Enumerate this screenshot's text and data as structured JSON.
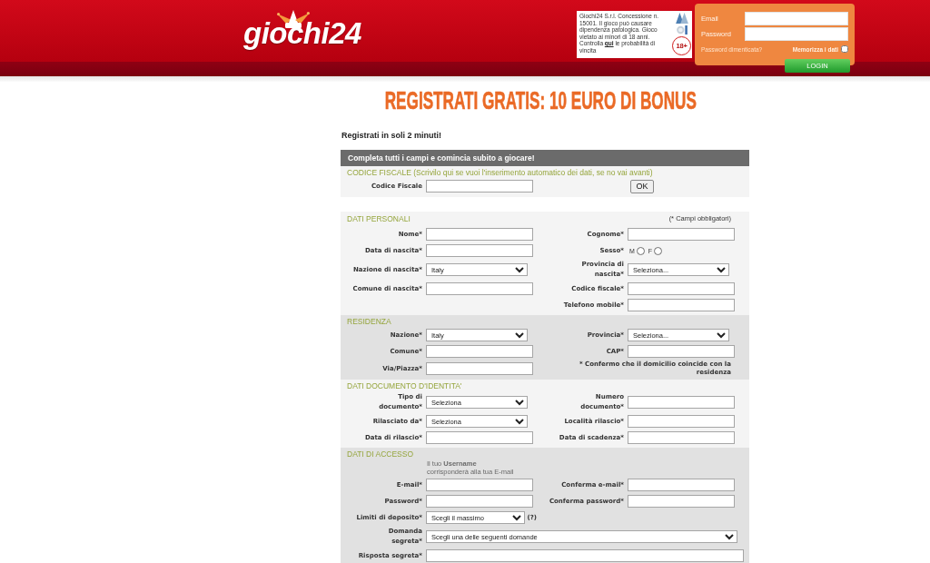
{
  "header": {
    "logo": "giochi24",
    "disclaimer": {
      "text": "Giochi24 S.r.l. Concessione n. 15001. Il gioco può causare dipendenza patologica. Gioco vietato ai minori di 18 anni. Controlla",
      "link": "qui",
      "text_after": "le probabilità di vincita"
    },
    "age_badge": "18+"
  },
  "login": {
    "email_label": "Email",
    "password_label": "Password",
    "forgot_password": "Password dimenticata?",
    "remember": {
      "label": "Memorizza i dati",
      "checked": false
    },
    "button": "LOGIN"
  },
  "banner_title": "REGISTRATI GRATIS: 10 EURO DI BONUS",
  "intro": "Registrati in soli 2 minuti!",
  "form": {
    "header": "Completa tutti i campi e comincia subito a giocare!",
    "sections": [
      {
        "kind": "lookup",
        "title": "CODICE FISCALE (Scrivilo qui se vuoi l'inserimento automatico dei dati, se no vai avanti)",
        "shaded": false,
        "rows": [
          {
            "left": {
              "kind": "text",
              "label": "Codice Fiscale"
            },
            "right": {
              "kind": "button",
              "text": "OK"
            }
          }
        ]
      },
      {
        "kind": "fields",
        "title": "DATI PERSONALI",
        "note": "(* Campi obbligatori)",
        "shaded": false,
        "rows": [
          {
            "left": {
              "kind": "text",
              "label": "Nome*"
            },
            "right": {
              "kind": "text",
              "label": "Cognome*"
            }
          },
          {
            "left": {
              "kind": "text",
              "label": "Data di nascita*"
            },
            "right": {
              "kind": "radio",
              "label": "Sesso*",
              "options": [
                {
                  "label": "M",
                  "selected": false
                },
                {
                  "label": "F",
                  "selected": false
                }
              ]
            }
          },
          {
            "left": {
              "kind": "select",
              "label": "Nazione di nascita*",
              "value": "Italy"
            },
            "right": {
              "kind": "select",
              "label": "Provincia di\nnascita*",
              "value": "Seleziona..."
            }
          },
          {
            "left": {
              "kind": "text",
              "label": "Comune di nascita*"
            },
            "right": {
              "kind": "text",
              "label": "Codice fiscale*"
            }
          },
          {
            "right": {
              "kind": "text",
              "label": "Telefono mobile*"
            }
          }
        ]
      },
      {
        "kind": "fields",
        "title": "RESIDENZA",
        "shaded": true,
        "rows": [
          {
            "left": {
              "kind": "select",
              "label": "Nazione*",
              "value": "Italy"
            },
            "right": {
              "kind": "select",
              "label": "Provincia*",
              "value": "Seleziona..."
            }
          },
          {
            "left": {
              "kind": "text",
              "label": "Comune*"
            },
            "right": {
              "kind": "text",
              "label": "CAP*"
            }
          },
          {
            "left": {
              "kind": "text",
              "label": "Via/Piazza*"
            },
            "right": {
              "kind": "note",
              "text": "* Confermo che il domicilio coincide con la residenza"
            }
          }
        ]
      },
      {
        "kind": "fields",
        "title": "DATI DOCUMENTO D'IDENTITA'",
        "shaded": false,
        "rows": [
          {
            "left": {
              "kind": "select",
              "label": "Tipo di\ndocumento*",
              "value": "Seleziona"
            },
            "right": {
              "kind": "text",
              "label": "Numero\ndocumento*"
            }
          },
          {
            "left": {
              "kind": "select",
              "label": "Rilasciato da*",
              "value": "Seleziona"
            },
            "right": {
              "kind": "text",
              "label": "Località rilascio*"
            }
          },
          {
            "left": {
              "kind": "text",
              "label": "Data di rilascio*"
            },
            "right": {
              "kind": "text",
              "label": "Data di scadenza*"
            }
          }
        ]
      },
      {
        "kind": "fields",
        "title": "DATI DI ACCESSO",
        "shaded": true,
        "rows": [
          {
            "left": {
              "kind": "info",
              "lines": [
                "Il tuo **Username**",
                "corrisponderà alla tua E-mail"
              ]
            }
          },
          {
            "left": {
              "kind": "text",
              "label": "E-mail*"
            },
            "right": {
              "kind": "text",
              "label": "Conferma e-mail*"
            }
          },
          {
            "left": {
              "kind": "text",
              "label": "Password*"
            },
            "right": {
              "kind": "text",
              "label": "Conferma password*"
            }
          },
          {
            "left": {
              "kind": "select",
              "label": "Limiti di deposito*",
              "value": "Scegli il massimo",
              "help": "(?)"
            }
          },
          {
            "wide": {
              "kind": "select",
              "label": "Domanda\nsegreta*",
              "value": "Scegli una delle seguenti domande"
            }
          },
          {
            "wide": {
              "kind": "text",
              "label": "Risposta segreta*"
            }
          }
        ]
      }
    ]
  }
}
